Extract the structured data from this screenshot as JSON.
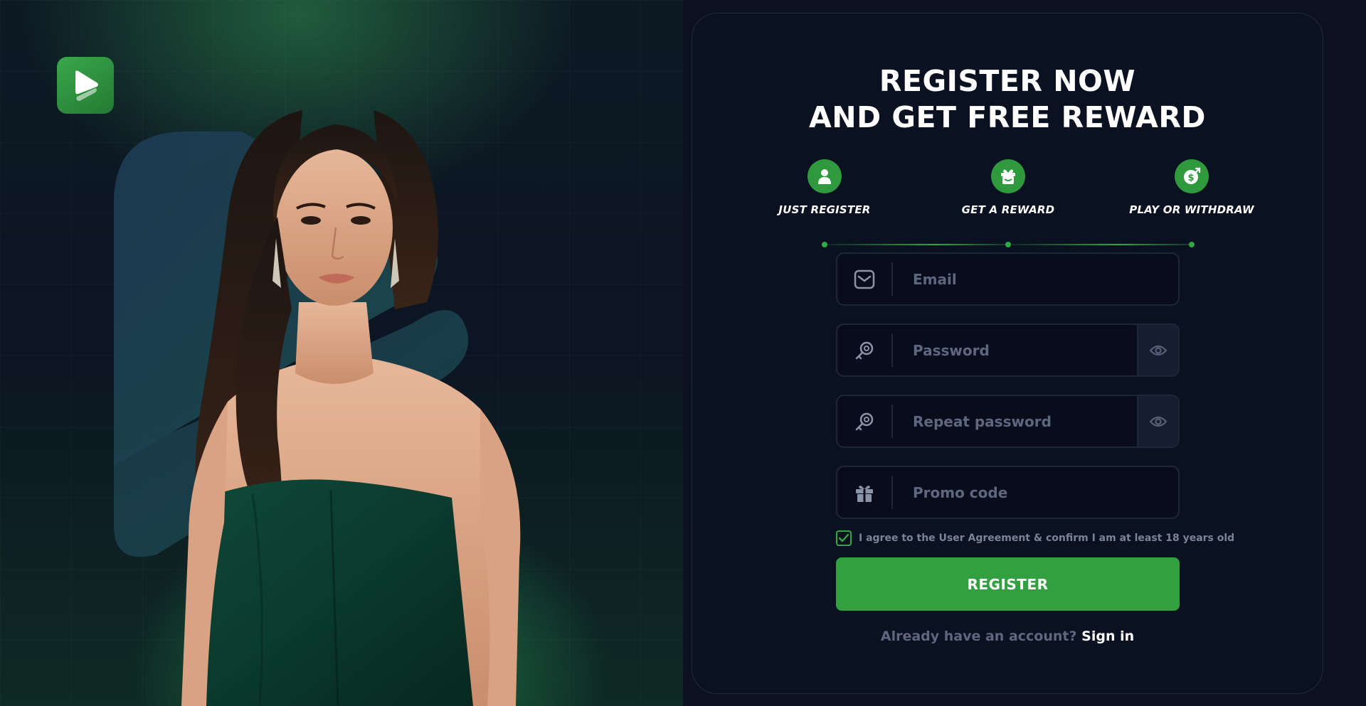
{
  "title": {
    "line1": "REGISTER NOW",
    "line2": "AND GET FREE REWARD"
  },
  "steps": [
    {
      "label": "JUST REGISTER",
      "icon": "user-icon"
    },
    {
      "label": "GET A REWARD",
      "icon": "gift-box-icon"
    },
    {
      "label": "PLAY OR WITHDRAW",
      "icon": "money-bag-icon"
    }
  ],
  "form": {
    "email": {
      "placeholder": "Email",
      "value": "",
      "icon": "mail-icon"
    },
    "password": {
      "placeholder": "Password",
      "value": "",
      "icon": "key-icon"
    },
    "repeat_password": {
      "placeholder": "Repeat password",
      "value": "",
      "icon": "key-icon"
    },
    "promo": {
      "placeholder": "Promo code",
      "value": "",
      "icon": "gift-icon"
    },
    "agreement_text": "I agree to the User Agreement & confirm I am at least 18 years old",
    "agreement_checked": true,
    "submit_label": "REGISTER"
  },
  "signin": {
    "question": "Already have an account?",
    "link": "Sign in"
  },
  "colors": {
    "accent": "#32a040",
    "panel_bg": "#0a1120",
    "page_bg": "#0b1120",
    "muted_text": "#5e6780"
  }
}
